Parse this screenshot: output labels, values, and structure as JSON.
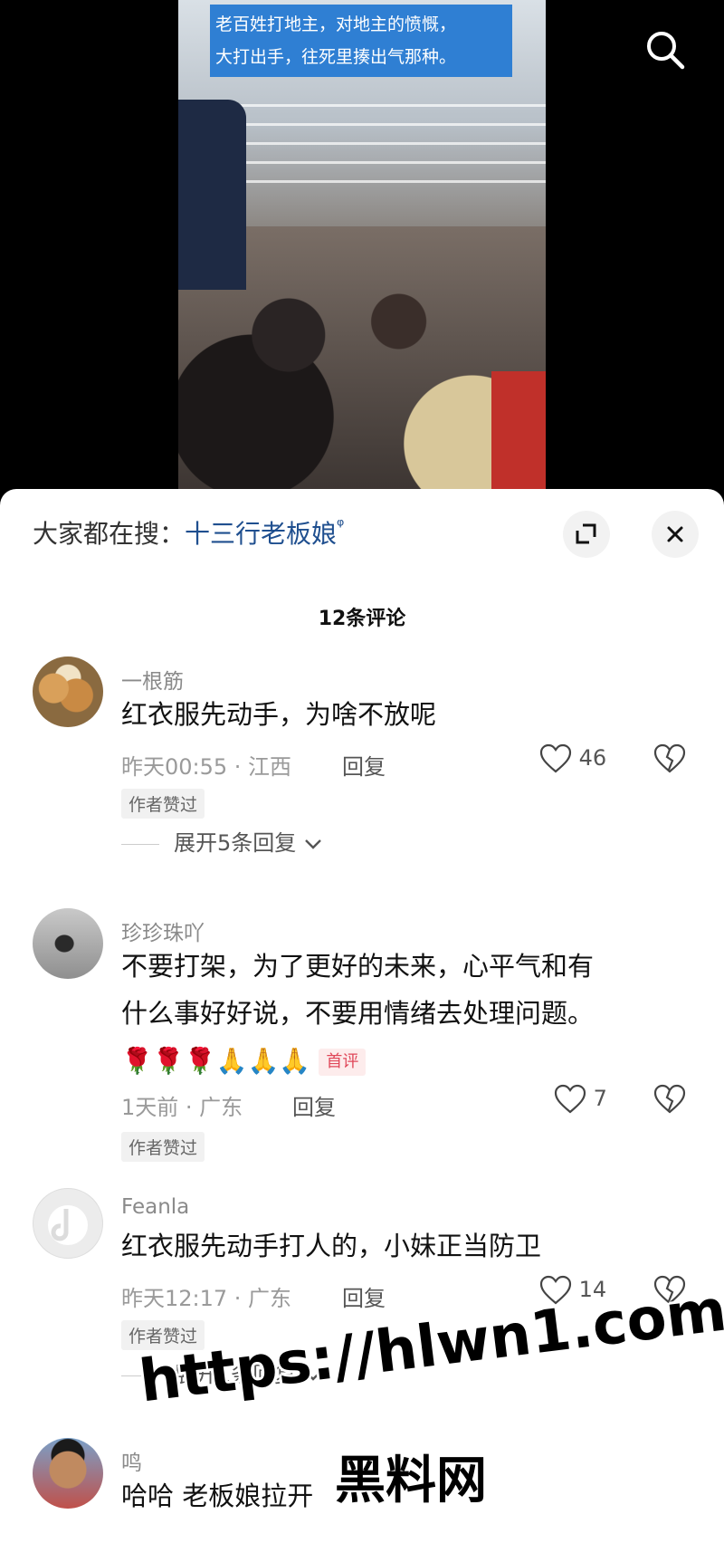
{
  "video": {
    "subtitle_line1": "老百姓打地主，对地主的愤慨，",
    "subtitle_line2": "大打出手，往死里揍出气那种。"
  },
  "panel": {
    "suggest_prefix": "大家都在搜：",
    "suggest_query": "十三行老板娘",
    "comment_count": "12条评论"
  },
  "comments": [
    {
      "username": "一根筋",
      "text": "红衣服先动手，为啥不放呢",
      "meta": "昨天00:55 · 江西",
      "reply_label": "回复",
      "likes": "46",
      "badge": "作者赞过",
      "expand": "展开5条回复"
    },
    {
      "username": "珍珍珠吖",
      "text_line1": "不要打架，为了更好的未来，心平气和有",
      "text_line2": "什么事好好说，不要用情绪去处理问题。",
      "emojis": "🌹🌹🌹🙏🙏🙏",
      "tag": "首评",
      "meta": "1天前 · 广东",
      "reply_label": "回复",
      "likes": "7",
      "badge": "作者赞过"
    },
    {
      "username": "Feanla",
      "text": "红衣服先动手打人的，小妹正当防卫",
      "meta": "昨天12:17 · 广东",
      "reply_label": "回复",
      "likes": "14",
      "badge": "作者赞过",
      "expand": "展开1条回复"
    },
    {
      "username": "鸣",
      "text": "哈哈 老板娘拉开"
    }
  ],
  "watermark": {
    "line1": "https://hlwn1.com",
    "line2": "黑料网"
  },
  "icons": {
    "search": "search-icon",
    "expand": "expand-icon",
    "close": "close-icon",
    "like": "heart-icon",
    "dislike": "broken-heart-icon",
    "chevron": "chevron-down-icon"
  }
}
